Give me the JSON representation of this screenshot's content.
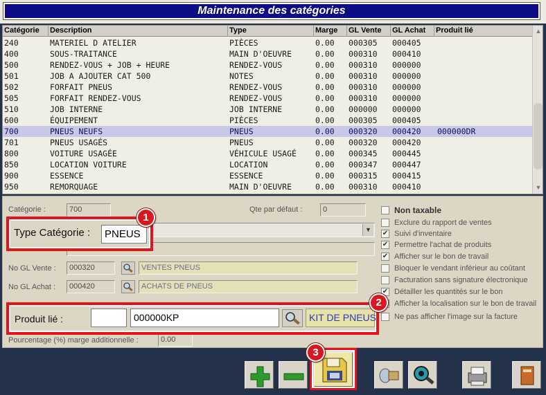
{
  "window": {
    "title": "Maintenance des catégories"
  },
  "grid": {
    "columns": [
      "Catégorie",
      "Description",
      "Type",
      "Marge",
      "GL Vente",
      "GL Achat",
      "Produit lié"
    ],
    "rows": [
      [
        "240",
        "MATERIEL D ATELIER",
        "PIÈCES",
        "0.00",
        "000305",
        "000405",
        ""
      ],
      [
        "400",
        "SOUS-TRAITANCE",
        "MAIN D'OEUVRE",
        "0.00",
        "000310",
        "000410",
        ""
      ],
      [
        "500",
        "RENDEZ-VOUS + JOB + HEURE",
        "RENDEZ-VOUS",
        "0.00",
        "000310",
        "000000",
        ""
      ],
      [
        "501",
        "JOB A AJOUTER CAT 500",
        "NOTES",
        "0.00",
        "000310",
        "000000",
        ""
      ],
      [
        "502",
        "FORFAIT PNEUS",
        "RENDEZ-VOUS",
        "0.00",
        "000310",
        "000000",
        ""
      ],
      [
        "505",
        "FORFAIT RENDEZ-VOUS",
        "RENDEZ-VOUS",
        "0.00",
        "000310",
        "000000",
        ""
      ],
      [
        "510",
        "JOB INTERNE",
        "JOB INTERNE",
        "0.00",
        "000000",
        "000000",
        ""
      ],
      [
        "600",
        "ÉQUIPEMENT",
        "PIÈCES",
        "0.00",
        "000305",
        "000405",
        ""
      ],
      [
        "700",
        "PNEUS NEUFS",
        "PNEUS",
        "0.00",
        "000320",
        "000420",
        "000000DR"
      ],
      [
        "701",
        "PNEUS USAGÉS",
        "PNEUS",
        "0.00",
        "000320",
        "000420",
        ""
      ],
      [
        "800",
        "VOITURE USAGÉE",
        "VÉHICULE USAGÉ",
        "0.00",
        "000345",
        "000445",
        ""
      ],
      [
        "850",
        "LOCATION VOITURE",
        "LOCATION",
        "0.00",
        "000347",
        "000447",
        ""
      ],
      [
        "900",
        "ESSENCE",
        "ESSENCE",
        "0.00",
        "000315",
        "000415",
        ""
      ],
      [
        "950",
        "REMORQUAGE",
        "MAIN D'OEUVRE",
        "0.00",
        "000310",
        "000410",
        ""
      ]
    ],
    "selected_row": 8
  },
  "form": {
    "categorie_label": "Catégorie :",
    "categorie_value": "700",
    "qte_label": "Qte par défaut :",
    "qte_value": "0",
    "type_label": "Type Catégorie :",
    "type_value": "PNEUS",
    "gl_vente_label": "No GL Vente :",
    "gl_vente_value": "000320",
    "gl_vente_desc": "VENTES PNEUS",
    "gl_achat_label": "No GL Achat :",
    "gl_achat_value": "000420",
    "gl_achat_desc": "ACHATS DE PNEUS",
    "produit_label": "Produit lié :",
    "produit_value": "000000KP",
    "produit_desc": "KIT DE PNEUS",
    "pourcentage_label": "Pourcentage (%) marge additionnelle :",
    "pourcentage_value": "0.00"
  },
  "options": [
    {
      "label": "Non taxable",
      "checked": false
    },
    {
      "label": "Exclure du rapport de ventes",
      "checked": false
    },
    {
      "label": "Suivi d'inventaire",
      "checked": true
    },
    {
      "label": "Permettre l'achat de produits",
      "checked": true
    },
    {
      "label": "Afficher sur le bon de travail",
      "checked": true
    },
    {
      "label": "Bloquer le vendant inférieur au coûtant",
      "checked": false
    },
    {
      "label": "Facturation sans signature électronique",
      "checked": false
    },
    {
      "label": "Détailler les quantités sur le bon",
      "checked": true
    },
    {
      "label": "Afficher la localisation sur le bon de travail",
      "checked": false
    },
    {
      "label": "Ne pas afficher l'image sur la facture",
      "checked": false
    }
  ],
  "badges": {
    "one": "1",
    "two": "2",
    "three": "3"
  },
  "colors": {
    "title_bar": "#0c0c84",
    "callout": "#e4141a",
    "selection": "#c9c8e6"
  }
}
